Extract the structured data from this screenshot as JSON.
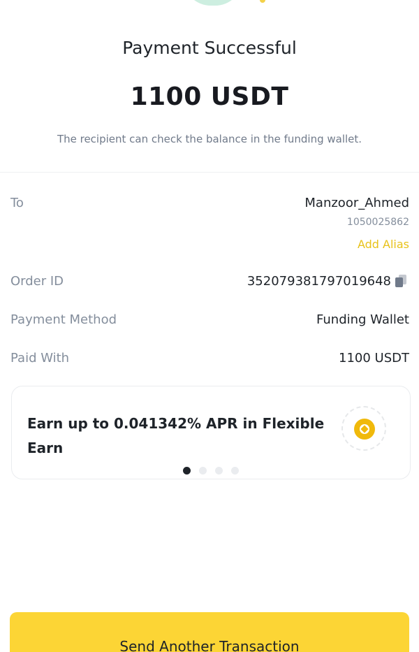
{
  "header": {
    "status_title": "Payment Successful",
    "amount": "1100 USDT",
    "subtitle": "The recipient can check the balance in the funding wallet."
  },
  "details": {
    "to": {
      "label": "To",
      "name": "Manzoor_Ahmed",
      "id": "1050025862",
      "alias_action": "Add Alias"
    },
    "order_id": {
      "label": "Order ID",
      "value": "352079381797019648",
      "icon": "copy-icon"
    },
    "payment_method": {
      "label": "Payment Method",
      "value": "Funding Wallet"
    },
    "paid_with": {
      "label": "Paid With",
      "value": "1100 USDT"
    }
  },
  "promo": {
    "text": "Earn up to 0.041342% APR in Flexible Earn",
    "icon": "earn-coin-icon",
    "carousel_count": 4,
    "carousel_active_index": 0
  },
  "footer": {
    "button_label": "Send Another Transaction"
  },
  "colors": {
    "accent_yellow": "#fcd535",
    "alias_yellow": "#e8c21a",
    "muted_text": "#848e9c",
    "coin": "#f0b90b"
  }
}
